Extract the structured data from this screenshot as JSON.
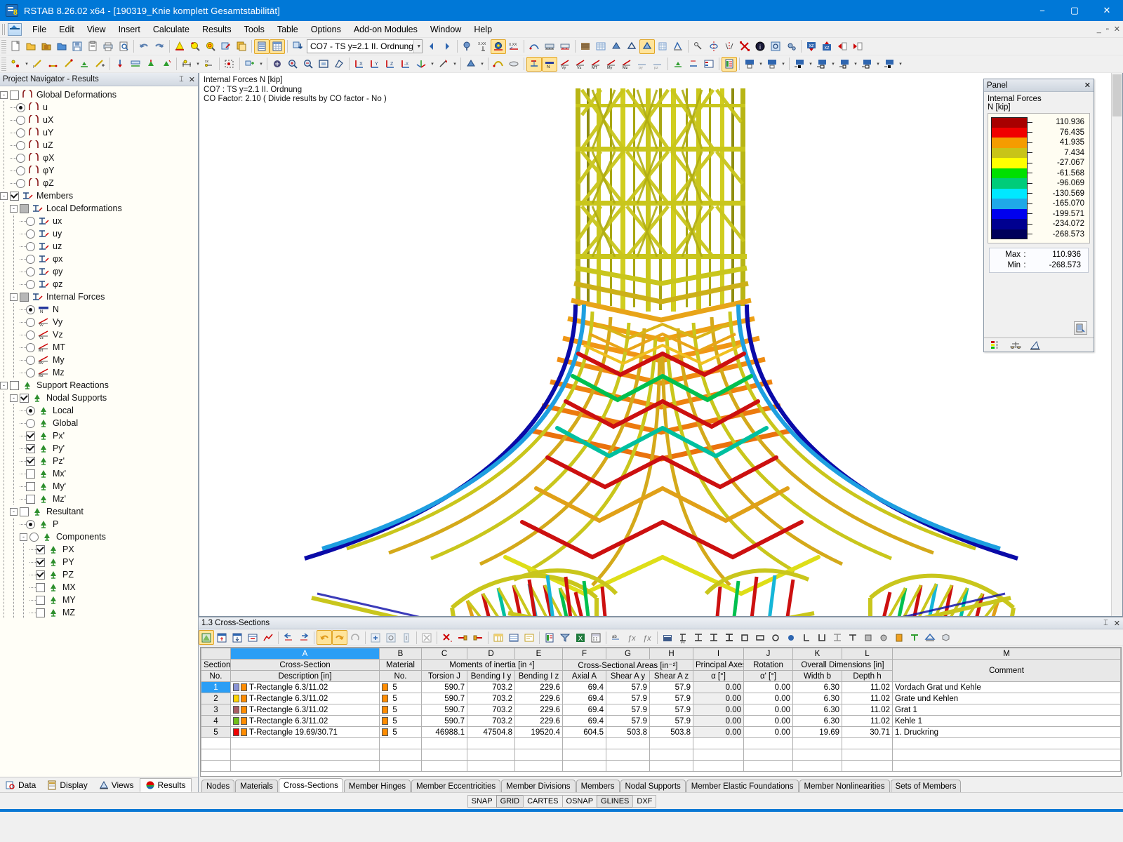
{
  "window": {
    "title": "RSTAB 8.26.02 x64 - [190319_Knie komplett Gesamtstabilität]",
    "minimize": "−",
    "maximize": "▢",
    "close": "✕",
    "mdi_minimize": "_",
    "mdi_restore": "▫",
    "mdi_close": "✕"
  },
  "menu": {
    "items": [
      "File",
      "Edit",
      "View",
      "Insert",
      "Calculate",
      "Results",
      "Tools",
      "Table",
      "Options",
      "Add-on Modules",
      "Window",
      "Help"
    ]
  },
  "toolbar": {
    "load_case_combo": "CO7 - TS y=2.1 II. Ordnung",
    "dropdown_glyph": "▼",
    "internal_force_labels": [
      "Vy",
      "Vz",
      "MT",
      "My",
      "Mz",
      "py",
      "pz"
    ],
    "section_shape_labels": [
      "IPE",
      "HE-A",
      "HE-B",
      "HE-M",
      "QRO",
      "RRO",
      "RO",
      "RD",
      "L",
      "U",
      "IS",
      "TS",
      "REC",
      "CIR",
      "REC",
      "TH"
    ],
    "fx_labels": [
      "ƒx",
      "ƒx"
    ]
  },
  "navigator": {
    "title": "Project Navigator - Results",
    "pin_glyph": "⌶",
    "close_glyph": "✕",
    "tree": [
      {
        "label": "Global Deformations",
        "level": 0,
        "control": "checkbox",
        "state": "unchecked",
        "expander": "-",
        "icon": "deformation-icon"
      },
      {
        "label": "u",
        "level": 1,
        "control": "radio",
        "state": "selected",
        "icon": "deformation-icon"
      },
      {
        "label": "uX",
        "level": 1,
        "control": "radio",
        "state": "off",
        "icon": "deformation-icon"
      },
      {
        "label": "uY",
        "level": 1,
        "control": "radio",
        "state": "off",
        "icon": "deformation-icon"
      },
      {
        "label": "uZ",
        "level": 1,
        "control": "radio",
        "state": "off",
        "icon": "deformation-icon"
      },
      {
        "label": "φX",
        "level": 1,
        "control": "radio",
        "state": "off",
        "icon": "deformation-icon"
      },
      {
        "label": "φY",
        "level": 1,
        "control": "radio",
        "state": "off",
        "icon": "deformation-icon"
      },
      {
        "label": "φZ",
        "level": 1,
        "control": "radio",
        "state": "off",
        "icon": "deformation-icon"
      },
      {
        "label": "Members",
        "level": 0,
        "control": "checkbox",
        "state": "checked",
        "expander": "-",
        "icon": "member-icon"
      },
      {
        "label": "Local Deformations",
        "level": 1,
        "control": "checkbox",
        "state": "grey",
        "expander": "-",
        "icon": "member-icon"
      },
      {
        "label": "ux",
        "level": 2,
        "control": "radio",
        "state": "off",
        "icon": "member-icon"
      },
      {
        "label": "uy",
        "level": 2,
        "control": "radio",
        "state": "off",
        "icon": "member-icon"
      },
      {
        "label": "uz",
        "level": 2,
        "control": "radio",
        "state": "off",
        "icon": "member-icon"
      },
      {
        "label": "φx",
        "level": 2,
        "control": "radio",
        "state": "off",
        "icon": "member-icon"
      },
      {
        "label": "φy",
        "level": 2,
        "control": "radio",
        "state": "off",
        "icon": "member-icon"
      },
      {
        "label": "φz",
        "level": 2,
        "control": "radio",
        "state": "off",
        "icon": "member-icon"
      },
      {
        "label": "Internal Forces",
        "level": 1,
        "control": "checkbox",
        "state": "grey",
        "expander": "-",
        "icon": "member-icon"
      },
      {
        "label": "N",
        "level": 2,
        "control": "radio",
        "state": "selected",
        "icon": "force-n-icon"
      },
      {
        "label": "Vy",
        "level": 2,
        "control": "radio",
        "state": "off",
        "icon": "force-vy-icon"
      },
      {
        "label": "Vz",
        "level": 2,
        "control": "radio",
        "state": "off",
        "icon": "force-vz-icon"
      },
      {
        "label": "MT",
        "level": 2,
        "control": "radio",
        "state": "off",
        "icon": "force-mt-icon"
      },
      {
        "label": "My",
        "level": 2,
        "control": "radio",
        "state": "off",
        "icon": "force-my-icon"
      },
      {
        "label": "Mz",
        "level": 2,
        "control": "radio",
        "state": "off",
        "icon": "force-mz-icon"
      },
      {
        "label": "Support Reactions",
        "level": 0,
        "control": "checkbox",
        "state": "unchecked",
        "expander": "-",
        "icon": "support-icon"
      },
      {
        "label": "Nodal Supports",
        "level": 1,
        "control": "checkbox",
        "state": "checked",
        "expander": "-",
        "icon": "support-icon"
      },
      {
        "label": "Local",
        "level": 2,
        "control": "radio",
        "state": "selected",
        "icon": "support-icon"
      },
      {
        "label": "Global",
        "level": 2,
        "control": "radio",
        "state": "off",
        "icon": "support-icon"
      },
      {
        "label": "Px'",
        "level": 2,
        "control": "checkbox",
        "state": "checked",
        "icon": "support-icon"
      },
      {
        "label": "Py'",
        "level": 2,
        "control": "checkbox",
        "state": "checked",
        "icon": "support-icon"
      },
      {
        "label": "Pz'",
        "level": 2,
        "control": "checkbox",
        "state": "checked",
        "icon": "support-icon"
      },
      {
        "label": "Mx'",
        "level": 2,
        "control": "checkbox",
        "state": "unchecked",
        "icon": "support-icon"
      },
      {
        "label": "My'",
        "level": 2,
        "control": "checkbox",
        "state": "unchecked",
        "icon": "support-icon"
      },
      {
        "label": "Mz'",
        "level": 2,
        "control": "checkbox",
        "state": "unchecked",
        "icon": "support-icon"
      },
      {
        "label": "Resultant",
        "level": 1,
        "control": "checkbox",
        "state": "unchecked",
        "expander": "-",
        "icon": "support-icon"
      },
      {
        "label": "P",
        "level": 2,
        "control": "radio",
        "state": "selected",
        "icon": "support-icon"
      },
      {
        "label": "Components",
        "level": 2,
        "control": "radio",
        "state": "off",
        "expander": "-",
        "icon": "support-icon"
      },
      {
        "label": "PX",
        "level": 3,
        "control": "checkbox",
        "state": "checked",
        "icon": "support-icon"
      },
      {
        "label": "PY",
        "level": 3,
        "control": "checkbox",
        "state": "checked",
        "icon": "support-icon"
      },
      {
        "label": "PZ",
        "level": 3,
        "control": "checkbox",
        "state": "checked",
        "icon": "support-icon"
      },
      {
        "label": "MX",
        "level": 3,
        "control": "checkbox",
        "state": "unchecked",
        "icon": "support-icon"
      },
      {
        "label": "MY",
        "level": 3,
        "control": "checkbox",
        "state": "unchecked",
        "icon": "support-icon"
      },
      {
        "label": "MZ",
        "level": 3,
        "control": "checkbox",
        "state": "unchecked",
        "icon": "support-icon"
      }
    ],
    "tabs": [
      {
        "label": "Data",
        "icon": "data-icon",
        "active": false
      },
      {
        "label": "Display",
        "icon": "display-icon",
        "active": false
      },
      {
        "label": "Views",
        "icon": "views-icon",
        "active": false
      },
      {
        "label": "Results",
        "icon": "results-icon",
        "active": true
      }
    ]
  },
  "viewport": {
    "info_line1": "Internal Forces N [kip]",
    "info_line2": "CO7 : TS y=2.1 II. Ordnung",
    "info_line3": "CO Factor: 2.10 ( Divide results by CO factor - No )"
  },
  "panel": {
    "title": "Panel",
    "close_glyph": "✕",
    "heading": "Internal Forces",
    "unit": "N [kip]",
    "legend": [
      {
        "value": "110.936",
        "color": "#a80000"
      },
      {
        "value": "76.435",
        "color": "#f00000"
      },
      {
        "value": "41.935",
        "color": "#f59c00"
      },
      {
        "value": "7.434",
        "color": "#c8c418"
      },
      {
        "value": "-27.067",
        "color": "#ffff00"
      },
      {
        "value": "-61.568",
        "color": "#00e000"
      },
      {
        "value": "-96.069",
        "color": "#00cc7a"
      },
      {
        "value": "-130.569",
        "color": "#00e8ff"
      },
      {
        "value": "-165.070",
        "color": "#1fa8e8"
      },
      {
        "value": "-199.571",
        "color": "#0000ee"
      },
      {
        "value": "-234.072",
        "color": "#000090"
      },
      {
        "value": "-268.573",
        "color": "#00005a"
      }
    ],
    "max_label": "Max",
    "min_label": "Min",
    "colon": ":",
    "max_value": "110.936",
    "min_value": "-268.573",
    "tabs": [
      "color-legend-tab",
      "scale-tab",
      "display-factor-tab"
    ]
  },
  "table": {
    "title": "1.3 Cross-Sections",
    "pin_glyph": "⌶",
    "close_glyph": "✕",
    "column_letters": [
      "A",
      "B",
      "C",
      "D",
      "E",
      "F",
      "G",
      "H",
      "I",
      "J",
      "K",
      "L",
      "M"
    ],
    "group_headers": [
      {
        "label": "Section",
        "span": 1
      },
      {
        "label": "Cross-Section",
        "span": 1
      },
      {
        "label": "Material",
        "span": 1
      },
      {
        "label": "Moments of inertia [in ⁴]",
        "span": 3
      },
      {
        "label": "Cross-Sectional Areas [in⁻²]",
        "span": 3
      },
      {
        "label": "Principal Axes",
        "span": 1
      },
      {
        "label": "Rotation",
        "span": 1
      },
      {
        "label": "Overall Dimensions [in]",
        "span": 2
      },
      {
        "label": "Comment",
        "span": 1
      }
    ],
    "sub_headers": [
      "No.",
      "Description [in]",
      "No.",
      "Torsion J",
      "Bending I y",
      "Bending I z",
      "Axial A",
      "Shear A y",
      "Shear A z",
      "α [°]",
      "α' [°]",
      "Width b",
      "Depth h",
      ""
    ],
    "rows": [
      {
        "no": "1",
        "swatch1": "#8a94d6",
        "swatch2": "#ff8c00",
        "desc": "T-Rectangle 6.3/11.02",
        "mat": "5",
        "torsion": "590.7",
        "iy": "703.2",
        "iz": "229.6",
        "axial": "69.4",
        "shear_ay": "57.9",
        "shear_az": "57.9",
        "alpha": "0.00",
        "alpha2": "0.00",
        "width": "6.30",
        "depth": "11.02",
        "comment": "Vordach Grat und Kehle",
        "selected": true
      },
      {
        "no": "2",
        "swatch1": "#ffd400",
        "swatch2": "#ff8c00",
        "desc": "T-Rectangle 6.3/11.02",
        "mat": "5",
        "torsion": "590.7",
        "iy": "703.2",
        "iz": "229.6",
        "axial": "69.4",
        "shear_ay": "57.9",
        "shear_az": "57.9",
        "alpha": "0.00",
        "alpha2": "0.00",
        "width": "6.30",
        "depth": "11.02",
        "comment": "Grate und Kehlen",
        "selected": false
      },
      {
        "no": "3",
        "swatch1": "#a85c63",
        "swatch2": "#ff8c00",
        "desc": "T-Rectangle 6.3/11.02",
        "mat": "5",
        "torsion": "590.7",
        "iy": "703.2",
        "iz": "229.6",
        "axial": "69.4",
        "shear_ay": "57.9",
        "shear_az": "57.9",
        "alpha": "0.00",
        "alpha2": "0.00",
        "width": "6.30",
        "depth": "11.02",
        "comment": "Grat 1",
        "selected": false
      },
      {
        "no": "4",
        "swatch1": "#6fbf1a",
        "swatch2": "#ff8c00",
        "desc": "T-Rectangle 6.3/11.02",
        "mat": "5",
        "torsion": "590.7",
        "iy": "703.2",
        "iz": "229.6",
        "axial": "69.4",
        "shear_ay": "57.9",
        "shear_az": "57.9",
        "alpha": "0.00",
        "alpha2": "0.00",
        "width": "6.30",
        "depth": "11.02",
        "comment": "Kehle 1",
        "selected": false
      },
      {
        "no": "5",
        "swatch1": "#f00000",
        "swatch2": "#ff8c00",
        "desc": "T-Rectangle 19.69/30.71",
        "mat": "5",
        "torsion": "46988.1",
        "iy": "47504.8",
        "iz": "19520.4",
        "axial": "604.5",
        "shear_ay": "503.8",
        "shear_az": "503.8",
        "alpha": "0.00",
        "alpha2": "0.00",
        "width": "19.69",
        "depth": "30.71",
        "comment": "1. Druckring",
        "selected": false
      }
    ],
    "tabs": [
      {
        "label": "Nodes",
        "active": false
      },
      {
        "label": "Materials",
        "active": false
      },
      {
        "label": "Cross-Sections",
        "active": true
      },
      {
        "label": "Member Hinges",
        "active": false
      },
      {
        "label": "Member Eccentricities",
        "active": false
      },
      {
        "label": "Member Divisions",
        "active": false
      },
      {
        "label": "Members",
        "active": false
      },
      {
        "label": "Nodal Supports",
        "active": false
      },
      {
        "label": "Member Elastic Foundations",
        "active": false
      },
      {
        "label": "Member Nonlinearities",
        "active": false
      },
      {
        "label": "Sets of Members",
        "active": false
      }
    ]
  },
  "statusbar": {
    "segments": [
      {
        "label": "SNAP",
        "on": false
      },
      {
        "label": "GRID",
        "on": true
      },
      {
        "label": "CARTES",
        "on": false
      },
      {
        "label": "OSNAP",
        "on": false
      },
      {
        "label": "GLINES",
        "on": true
      },
      {
        "label": "DXF",
        "on": false
      }
    ]
  }
}
